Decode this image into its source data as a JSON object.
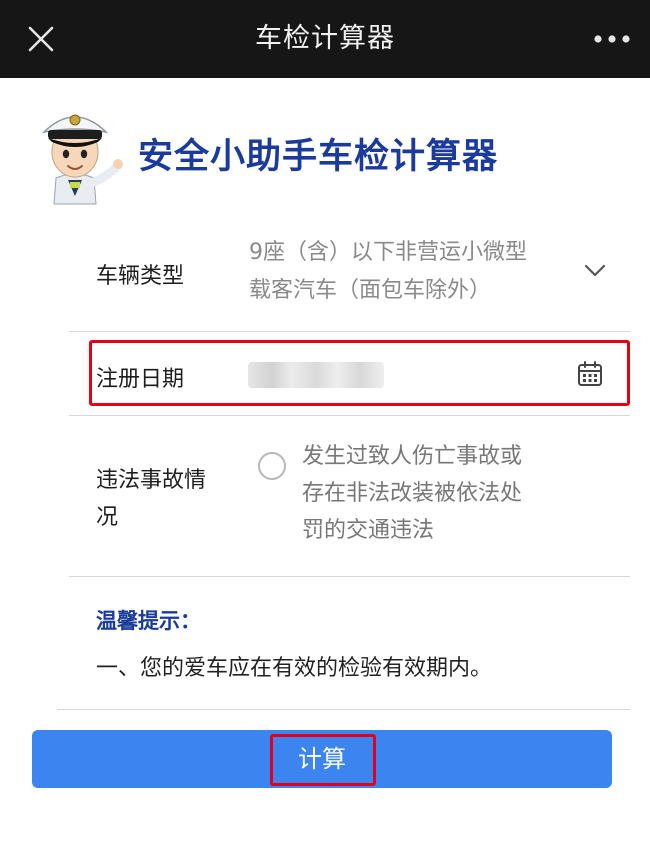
{
  "topbar": {
    "title": "车检计算器",
    "close_icon": "close-icon",
    "more_icon": "more-dots-icon"
  },
  "header": {
    "mascot": "police-mascot-icon",
    "brand_title": "安全小助手车检计算器"
  },
  "form": {
    "vehicle_type": {
      "label": "车辆类型",
      "value_line1": "9座（含）以下非营运小微型",
      "value_line2": "载客汽车（面包车除外）"
    },
    "register_date": {
      "label": "注册日期",
      "icon": "calendar-icon"
    },
    "violation": {
      "label_line1": "违法事故情",
      "label_line2": "况",
      "option_line1": "发生过致人伤亡事故或",
      "option_line2": "存在非法改装被依法处",
      "option_line3": "罚的交通违法",
      "checked": false
    }
  },
  "tips": {
    "title": "温馨提示：",
    "text": "一、您的爱车应在有效的检验有效期内。"
  },
  "calc_button": {
    "label": "计算"
  },
  "colors": {
    "topbar_bg": "#161616",
    "brand_blue": "#1a3a9c",
    "button_blue": "#3c84f0",
    "highlight_red": "#e3001b"
  }
}
